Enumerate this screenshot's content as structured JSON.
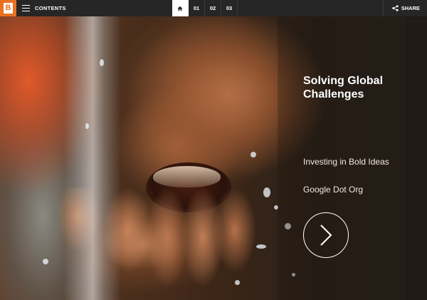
{
  "topbar": {
    "logo_icon": "publication-logo-icon",
    "contents_label": "CONTENTS",
    "nav": [
      {
        "label": "",
        "icon": "home-icon"
      },
      {
        "label": "01"
      },
      {
        "label": "02"
      },
      {
        "label": "03"
      }
    ],
    "share_label": "SHARE",
    "share_icon": "share-icon"
  },
  "hero": {
    "title": "Solving Global Challenges",
    "subtitle": "Investing in Bold Ideas",
    "byline": "Google Dot Org",
    "next_icon": "chevron-right-icon"
  },
  "colors": {
    "accent": "#e8711f",
    "topbar_bg": "#262626",
    "text": "#ffffff"
  }
}
